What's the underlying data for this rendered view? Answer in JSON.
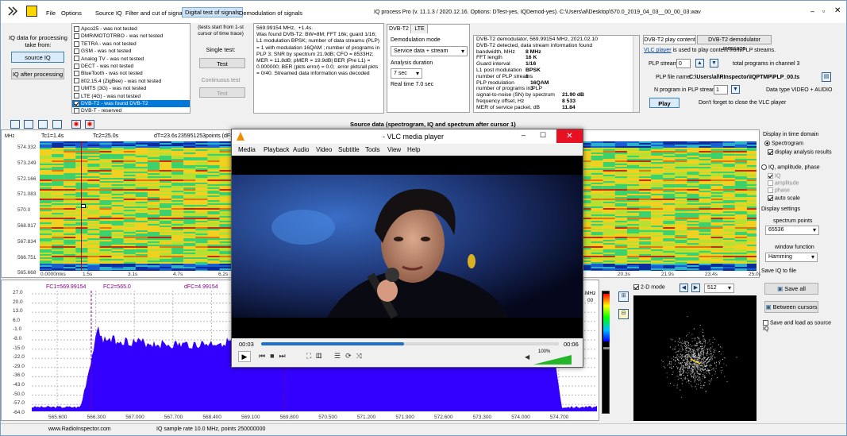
{
  "app": {
    "title": "IQ process Pro (v. 11.1.3 / 2020.12.16. Options: DTest-yes, IQDemod-yes). C:\\Users\\al\\Desktop\\570.0_2019_04_03__00_00_03.wav"
  },
  "menu": {
    "file": "File",
    "options": "Options",
    "source_iq": "Source IQ",
    "filter_cut": "Filter and cut of signal",
    "digital_test": "Digital test of signals",
    "demodulation": "Demodulation of signals"
  },
  "left": {
    "iq_label": "IQ data for processing take from:",
    "source_iq": "source IQ",
    "iq_after": "IQ after processing"
  },
  "systems": [
    {
      "label": "Apco25 - was not tested",
      "checked": false
    },
    {
      "label": "DMR/MOTOTRBO - was not tested",
      "checked": false
    },
    {
      "label": "TETRA - was not tested",
      "checked": false
    },
    {
      "label": "GSM - was not tested",
      "checked": false
    },
    {
      "label": "Analog TV - was not tested",
      "checked": false
    },
    {
      "label": "DECT - was not tested",
      "checked": false
    },
    {
      "label": "BlueTooth - was not tested",
      "checked": false
    },
    {
      "label": "802.15.4 (ZigBee) - was not tested",
      "checked": false
    },
    {
      "label": "UMTS (3G) - was not tested",
      "checked": false
    },
    {
      "label": "LTE (4G) - was not tested",
      "checked": false
    },
    {
      "label": "DVB-T2 - was found DVB-T2",
      "checked": true
    },
    {
      "label": "DVB-T - reserved",
      "checked": false
    }
  ],
  "tests": {
    "note": "(tests start from 1-st cursor of time trace)",
    "single": "Single test:",
    "test1": "Test",
    "continuous": "Continuous test",
    "test2": "Test"
  },
  "result_text": "569.99154 MHz,  +1.4s.\nWas found DVB-T2: BW=8M; FFT 16k; guard 1/16; L1 modulation BPSK; number of data streams (PLP) = 1 with modulation 16QAM ; number of programs in PLP 3; SNR by spectrum 21.9dB; CFO = 8533Hz; MER = 11.8dB; pMER = 19.9dB| BER (Pre L1) = 0.000000; BER (pkts error) = 0.0;  error pkts/all pkts = 0/40. Streamed data information was decoded",
  "demod": {
    "tab1": "DVB-T2",
    "tab2": "LTE",
    "mode_label": "Demodulation mode",
    "mode_value": "Service data + stream",
    "dur_label": "Analysis duration",
    "dur_value": "7 sec",
    "realtime": "Real time 7.0 sec"
  },
  "demod_info": {
    "header1": "DVB-T2 demodulator, 569.99154 MHz, 2021.02.10",
    "header2": "DVB-T2 detected, data stream information found",
    "rows": [
      {
        "k": "bandwidth, MHz",
        "v": "8 MHz"
      },
      {
        "k": "FFT length",
        "v": "16 K"
      },
      {
        "k": "Guard interval",
        "v": "1/16"
      },
      {
        "k": "L1 post modulation",
        "v": "BPSK"
      },
      {
        "k": "number of PLP streams",
        "v": "1"
      },
      {
        "k": "PLP modulation",
        "v": "16QAM"
      },
      {
        "k": "number of programs in PLP",
        "v": "3"
      },
      {
        "k": "signal-to-noise (SN) by spectrum",
        "v": "21.90 dB"
      },
      {
        "k": "frequency offset, Hz",
        "v": "8 533"
      },
      {
        "k": "MER of service packet, dB",
        "v": "11.84"
      }
    ]
  },
  "play": {
    "tab1": "DVB-T2 play content",
    "tab2": "DVB-T2 demodulator message",
    "vlc_link": "VLC player",
    "vlc_note": " is used to play content from PLP streams.",
    "plp_label": "PLP stream",
    "plp_value": "0",
    "total": "total programs in channel 3",
    "file_label": "PLP file name",
    "file_value": "C:\\Users\\al\\RInspector\\IQPTMP\\PLP_00.ts",
    "nprog_label": "N program in PLP stream",
    "nprog_value": "1",
    "dtype": "Data type VIDEO + AUDIO",
    "play_btn": "Play",
    "close_note": "Don't forget to close the VLC player"
  },
  "source_title": "Source data (spectrogram, IQ and spectrum after cursor 1)",
  "spectrogram": {
    "tc1": "Tc1=1.4s",
    "tc2": "Tc2=25.0s",
    "dt": "dT=23.6s",
    "points": "235951253points (dF=10",
    "mhz": "MHz",
    "y": [
      "574.332",
      "573.249",
      "572.166",
      "571.083",
      "570.0",
      "568.917",
      "567.834",
      "566.751",
      "565.668"
    ],
    "x0": "0.0000mks",
    "x": [
      "1.5s",
      "3.1s",
      "4.7s",
      "6.2s"
    ],
    "xr": [
      "20.3s",
      "21.9s",
      "23.4s",
      "25.0s"
    ]
  },
  "spectrum": {
    "fc1": "FC1=569.99154",
    "fc2": "FC2=565.0",
    "dfc": "dFC=4.99154",
    "y": [
      "27.0",
      "20.0",
      "13.0",
      "6.0",
      "-1.0",
      "-8.0",
      "-15.0",
      "-22.0",
      "-29.0",
      "-36.0",
      "-43.0",
      "-50.0",
      "-57.0",
      "-64.0"
    ],
    "x": [
      "565.600",
      "566.300",
      "567.000",
      "567.700",
      "568.400",
      "569.100",
      "569.800",
      "570.500",
      "571.200",
      "571.900",
      "572.600",
      "573.300",
      "574.000",
      "574.700"
    ],
    "side": "MHz",
    "side2": "00"
  },
  "iq": {
    "twod": "2-D mode",
    "points": "512"
  },
  "right": {
    "time_domain": "Display in time domain",
    "spectrogram": "Spectrogram",
    "analysis": "display analysis results",
    "iq_amp": "IQ, amplitude, phase",
    "iq": "IQ",
    "amplitude": "amplitude",
    "phase": "phase",
    "auto": "auto scale",
    "settings": "Display settings",
    "spec_points": "spectrum points",
    "spec_value": "65536",
    "window": "window function",
    "window_value": "Hamming",
    "save_title": "Save IQ to file",
    "save_all": "Save all",
    "between": "Between  cursors",
    "save_load": "Save and load as source IQ"
  },
  "status": {
    "site": "www.RadioInspector.com",
    "rate": "IQ sample rate 10.0 MHz, points 250000000"
  },
  "vlc": {
    "title": "- VLC media player",
    "menu": [
      "Media",
      "Playback",
      "Audio",
      "Video",
      "Subtitle",
      "Tools",
      "View",
      "Help"
    ],
    "time_start": "00:03",
    "time_end": "00:06",
    "volume": "100%"
  },
  "colors": {
    "accent": "#0078d7",
    "spectrum_fill": "#3300ff",
    "cursor": "#cc0000"
  }
}
